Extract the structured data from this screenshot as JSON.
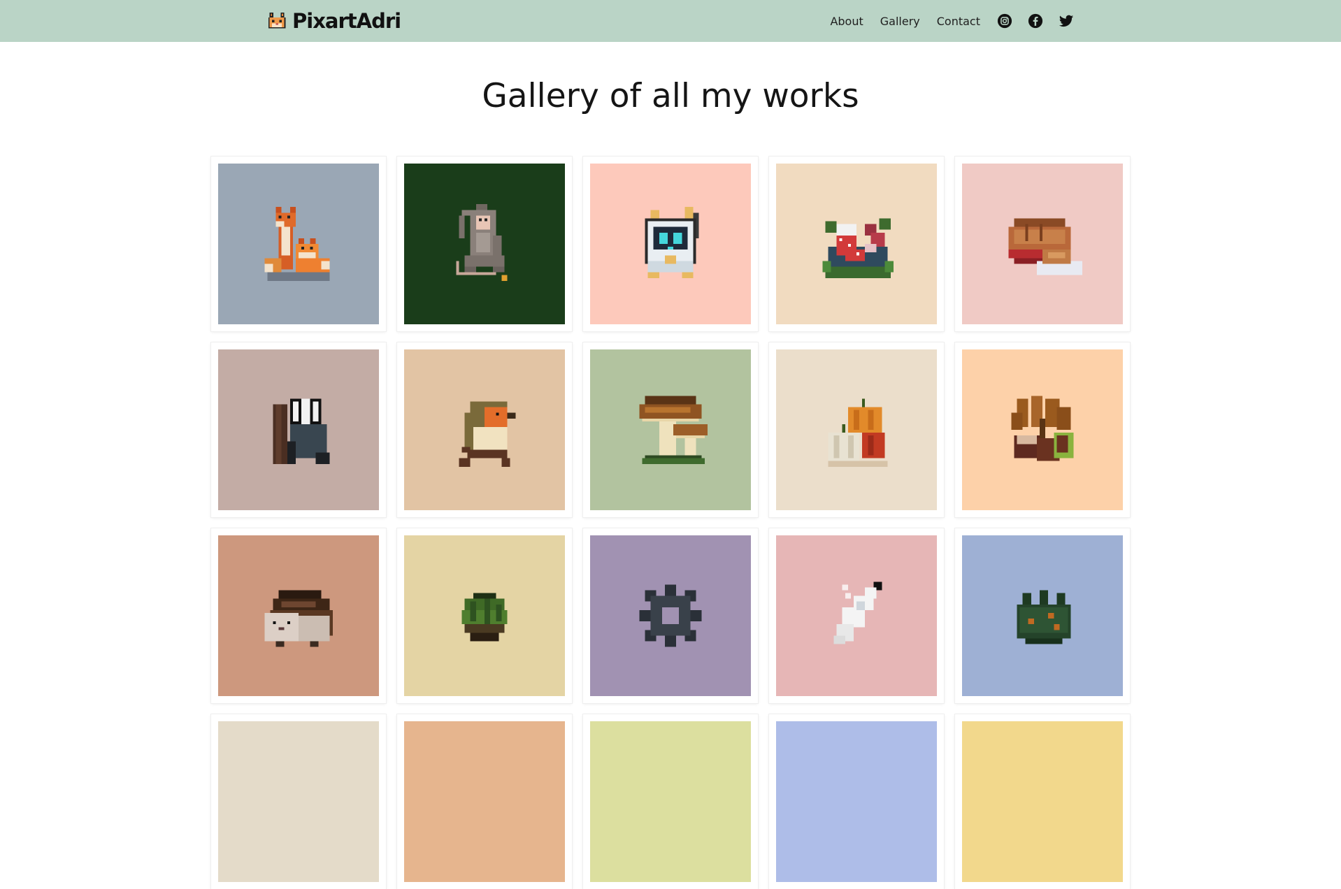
{
  "header": {
    "brand": "PixartAdri",
    "nav": [
      {
        "label": "About"
      },
      {
        "label": "Gallery"
      },
      {
        "label": "Contact"
      }
    ],
    "social_icons": [
      "instagram-icon",
      "facebook-icon",
      "twitter-icon"
    ],
    "background_color": "#bad4c6"
  },
  "page": {
    "title": "Gallery of all my works"
  },
  "gallery": {
    "items": [
      {
        "icon": "fox-family-icon",
        "background": "#9aa7b5"
      },
      {
        "icon": "monkey-icon",
        "background": "#1a3d1a"
      },
      {
        "icon": "robot-cat-icon",
        "background": "#fdc9bb"
      },
      {
        "icon": "christmas-stocking-icon",
        "background": "#f1dbc0"
      },
      {
        "icon": "pie-icon",
        "background": "#f0cac5"
      },
      {
        "icon": "badger-icon",
        "background": "#c3aca5"
      },
      {
        "icon": "robin-bird-icon",
        "background": "#e2c4a4"
      },
      {
        "icon": "mushrooms-icon",
        "background": "#b2c39f"
      },
      {
        "icon": "pumpkins-icon",
        "background": "#ebdecb"
      },
      {
        "icon": "chestnuts-icon",
        "background": "#fdd1a9"
      },
      {
        "icon": "hedgehog-icon",
        "background": "#cd987e"
      },
      {
        "icon": "cabbage-icon",
        "background": "#e4d4a4"
      },
      {
        "icon": "gear-icon",
        "background": "#a192b2"
      },
      {
        "icon": "milk-bottle-icon",
        "background": "#e6b6b6"
      },
      {
        "icon": "bush-icon",
        "background": "#9eb0d4"
      },
      {
        "icon": "artwork-icon",
        "background": "#e4dbc9"
      },
      {
        "icon": "artwork-icon",
        "background": "#e6b58e"
      },
      {
        "icon": "artwork-icon",
        "background": "#dcdf9f"
      },
      {
        "icon": "artwork-icon",
        "background": "#aebde8"
      },
      {
        "icon": "artwork-icon",
        "background": "#f2d88c"
      }
    ]
  }
}
